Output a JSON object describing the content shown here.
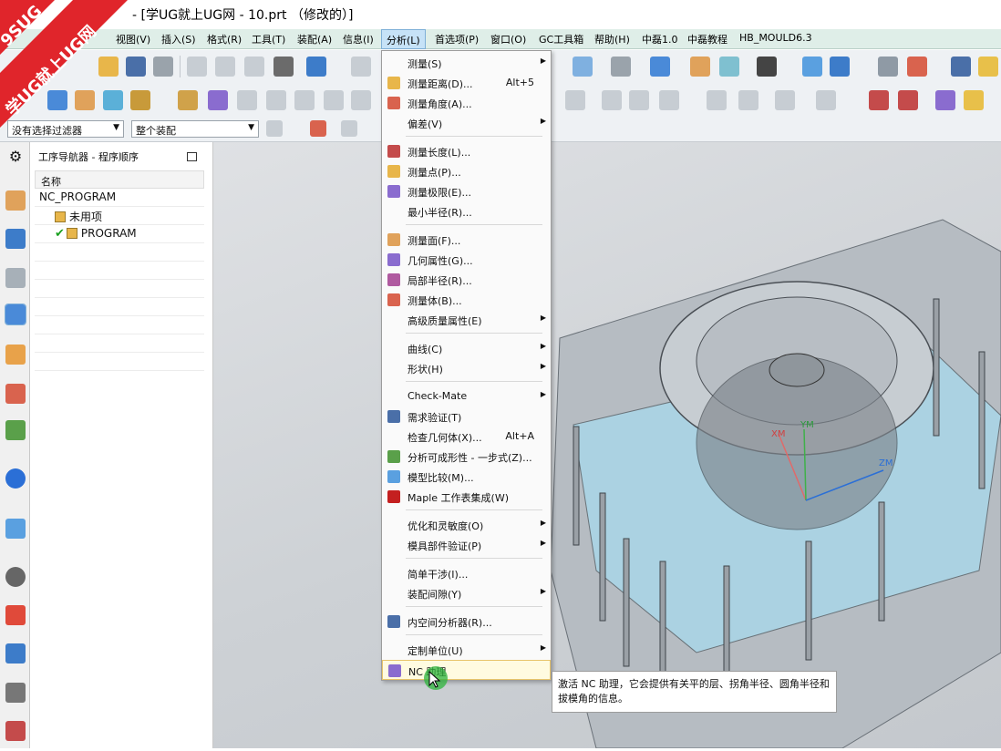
{
  "window": {
    "title": "- [学UG就上UG网 - 10.prt （修改的）]"
  },
  "watermark": {
    "line1": "9SUG",
    "line2": "学UG就上UG网"
  },
  "menubar": {
    "items": [
      "视图(V)",
      "插入(S)",
      "格式(R)",
      "工具(T)",
      "装配(A)",
      "信息(I)",
      "分析(L)",
      "首选项(P)",
      "窗口(O)",
      "GC工具箱",
      "帮助(H)",
      "中磊1.0",
      "中磊教程",
      "HB_MOULD6.3"
    ],
    "active": "分析(L)"
  },
  "filterbar": {
    "filter_value": "没有选择过滤器",
    "assembly_value": "整个装配"
  },
  "navigator": {
    "title": "工序导航器 - 程序顺序",
    "column_header": "名称",
    "rows": [
      "NC_PROGRAM",
      "未用项",
      "PROGRAM"
    ]
  },
  "analysis_menu": {
    "items": [
      {
        "label": "测量(S)",
        "submenu": true
      },
      {
        "label": "测量距离(D)...",
        "shortcut": "Alt+5"
      },
      {
        "label": "测量角度(A)..."
      },
      {
        "label": "偏差(V)",
        "submenu": true
      },
      {
        "label": "测量长度(L)..."
      },
      {
        "label": "测量点(P)..."
      },
      {
        "label": "测量极限(E)..."
      },
      {
        "label": "最小半径(R)..."
      },
      {
        "label": "测量面(F)..."
      },
      {
        "label": "几何属性(G)..."
      },
      {
        "label": "局部半径(R)..."
      },
      {
        "label": "测量体(B)..."
      },
      {
        "label": "高级质量属性(E)",
        "submenu": true
      },
      {
        "label": "曲线(C)",
        "submenu": true
      },
      {
        "label": "形状(H)",
        "submenu": true
      },
      {
        "label": "Check-Mate",
        "submenu": true
      },
      {
        "label": "需求验证(T)"
      },
      {
        "label": "检查几何体(X)...",
        "shortcut": "Alt+A"
      },
      {
        "label": "分析可成形性 - 一步式(Z)..."
      },
      {
        "label": "模型比较(M)..."
      },
      {
        "label": "Maple 工作表集成(W)"
      },
      {
        "label": "优化和灵敏度(O)",
        "submenu": true
      },
      {
        "label": "模具部件验证(P)",
        "submenu": true
      },
      {
        "label": "简单干涉(I)..."
      },
      {
        "label": "装配间隙(Y)",
        "submenu": true
      },
      {
        "label": "内空间分析器(R)..."
      },
      {
        "label": "定制单位(U)",
        "submenu": true
      },
      {
        "label": "NC 助理"
      }
    ],
    "highlighted": "NC 助理"
  },
  "tooltip": {
    "text": "激活 NC 助理，它会提供有关平的层、拐角半径、圆角半径和拔模角的信息。"
  },
  "viewport": {
    "axis_labels": [
      "XM",
      "YM",
      "ZM"
    ]
  },
  "colors": {
    "menubar_bg": "#dfeee8",
    "highlight": "#fffbe0",
    "accent_blue": "#2b6fd6",
    "watermark_red": "#e0252b"
  }
}
